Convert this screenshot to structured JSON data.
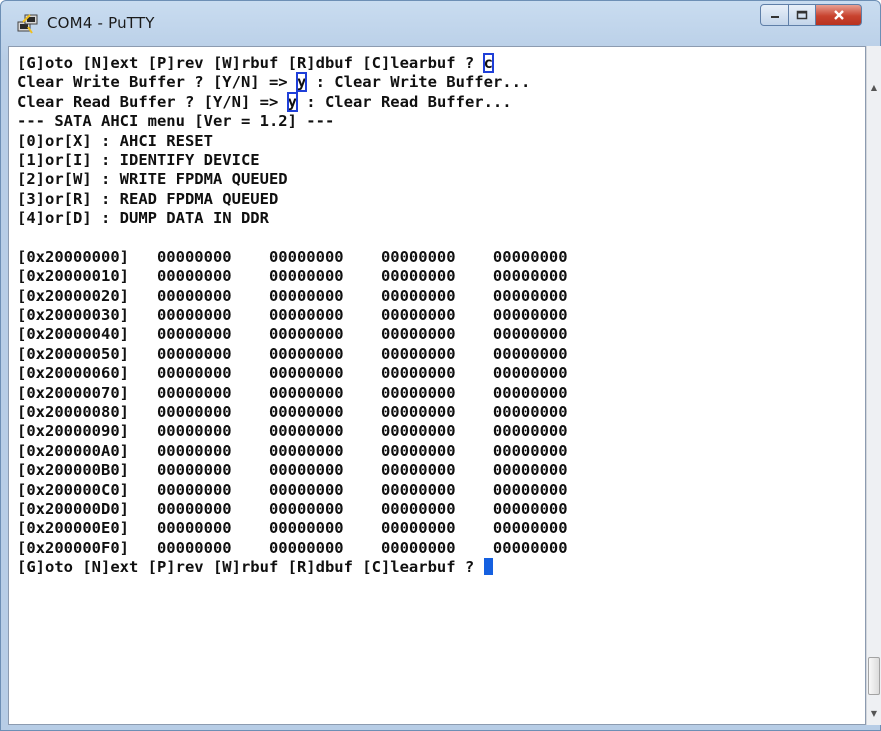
{
  "window": {
    "title": "COM4 - PuTTY",
    "icon": "putty-icon",
    "controls": {
      "minimize_icon": "minimize-icon",
      "maximize_icon": "maximize-icon",
      "close_icon": "close-icon"
    }
  },
  "terminal": {
    "lines": [
      [
        "[G]oto [N]ext [P]rev [W]rbuf [R]dbuf [C]learbuf ? ",
        {
          "hl": "c"
        }
      ],
      [
        "Clear Write Buffer ? [Y/N] => ",
        {
          "hl": "y"
        },
        " : Clear Write Buffer..."
      ],
      [
        "Clear Read Buffer ? [Y/N] => ",
        {
          "hl": "y"
        },
        " : Clear Read Buffer..."
      ],
      [
        "--- SATA AHCI menu [Ver = 1.2] ---"
      ],
      [
        "[0]or[X] : AHCI RESET"
      ],
      [
        "[1]or[I] : IDENTIFY DEVICE"
      ],
      [
        "[2]or[W] : WRITE FPDMA QUEUED"
      ],
      [
        "[3]or[R] : READ FPDMA QUEUED"
      ],
      [
        "[4]or[D] : DUMP DATA IN DDR"
      ],
      [
        ""
      ],
      [
        "[0x20000000]   00000000    00000000    00000000    00000000"
      ],
      [
        "[0x20000010]   00000000    00000000    00000000    00000000"
      ],
      [
        "[0x20000020]   00000000    00000000    00000000    00000000"
      ],
      [
        "[0x20000030]   00000000    00000000    00000000    00000000"
      ],
      [
        "[0x20000040]   00000000    00000000    00000000    00000000"
      ],
      [
        "[0x20000050]   00000000    00000000    00000000    00000000"
      ],
      [
        "[0x20000060]   00000000    00000000    00000000    00000000"
      ],
      [
        "[0x20000070]   00000000    00000000    00000000    00000000"
      ],
      [
        "[0x20000080]   00000000    00000000    00000000    00000000"
      ],
      [
        "[0x20000090]   00000000    00000000    00000000    00000000"
      ],
      [
        "[0x200000A0]   00000000    00000000    00000000    00000000"
      ],
      [
        "[0x200000B0]   00000000    00000000    00000000    00000000"
      ],
      [
        "[0x200000C0]   00000000    00000000    00000000    00000000"
      ],
      [
        "[0x200000D0]   00000000    00000000    00000000    00000000"
      ],
      [
        "[0x200000E0]   00000000    00000000    00000000    00000000"
      ],
      [
        "[0x200000F0]   00000000    00000000    00000000    00000000"
      ],
      [
        "[G]oto [N]ext [P]rev [W]rbuf [R]dbuf [C]learbuf ? ",
        {
          "cursor": true
        }
      ]
    ],
    "highlight_color": "#1f3fd8",
    "cursor_color": "#1560e0",
    "text_color": "#101010",
    "background": "#ffffff"
  },
  "scrollbar": {
    "up_icon": "scroll-up-arrow-icon",
    "down_icon": "scroll-down-arrow-icon"
  }
}
